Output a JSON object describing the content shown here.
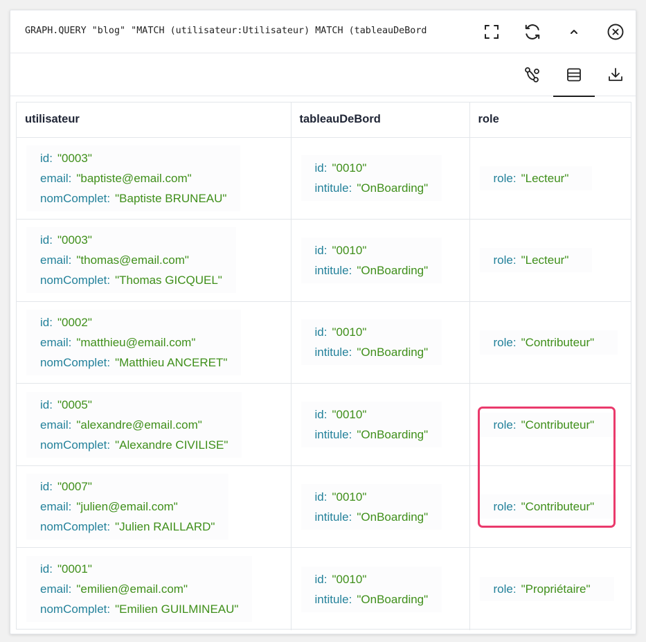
{
  "query": {
    "text": "GRAPH.QUERY \"blog\" \"MATCH (utilisateur:Utilisateur) MATCH (tableauDeBord",
    "icons": [
      "fullscreen-icon",
      "refresh-icon",
      "chevron-up-icon",
      "close-circle-icon"
    ]
  },
  "toolbar": {
    "icons": [
      "graph-view-icon",
      "table-view-icon",
      "download-icon"
    ],
    "active": "table-view"
  },
  "table": {
    "columns": [
      "utilisateur",
      "tableauDeBord",
      "role"
    ],
    "rows": [
      {
        "utilisateur": [
          [
            "id:",
            "\"0003\""
          ],
          [
            "email:",
            "\"baptiste@email.com\""
          ],
          [
            "nomComplet:",
            "\"Baptiste BRUNEAU\""
          ]
        ],
        "tableauDeBord": [
          [
            "id:",
            "\"0010\""
          ],
          [
            "intitule:",
            "\"OnBoarding\""
          ]
        ],
        "role": [
          [
            "role:",
            "\"Lecteur\""
          ]
        ]
      },
      {
        "utilisateur": [
          [
            "id:",
            "\"0003\""
          ],
          [
            "email:",
            "\"thomas@email.com\""
          ],
          [
            "nomComplet:",
            "\"Thomas GICQUEL\""
          ]
        ],
        "tableauDeBord": [
          [
            "id:",
            "\"0010\""
          ],
          [
            "intitule:",
            "\"OnBoarding\""
          ]
        ],
        "role": [
          [
            "role:",
            "\"Lecteur\""
          ]
        ]
      },
      {
        "utilisateur": [
          [
            "id:",
            "\"0002\""
          ],
          [
            "email:",
            "\"matthieu@email.com\""
          ],
          [
            "nomComplet:",
            "\"Matthieu ANCERET\""
          ]
        ],
        "tableauDeBord": [
          [
            "id:",
            "\"0010\""
          ],
          [
            "intitule:",
            "\"OnBoarding\""
          ]
        ],
        "role": [
          [
            "role:",
            "\"Contributeur\""
          ]
        ]
      },
      {
        "utilisateur": [
          [
            "id:",
            "\"0005\""
          ],
          [
            "email:",
            "\"alexandre@email.com\""
          ],
          [
            "nomComplet:",
            "\"Alexandre CIVILISE\""
          ]
        ],
        "tableauDeBord": [
          [
            "id:",
            "\"0010\""
          ],
          [
            "intitule:",
            "\"OnBoarding\""
          ]
        ],
        "role": [
          [
            "role:",
            "\"Contributeur\""
          ]
        ]
      },
      {
        "utilisateur": [
          [
            "id:",
            "\"0007\""
          ],
          [
            "email:",
            "\"julien@email.com\""
          ],
          [
            "nomComplet:",
            "\"Julien RAILLARD\""
          ]
        ],
        "tableauDeBord": [
          [
            "id:",
            "\"0010\""
          ],
          [
            "intitule:",
            "\"OnBoarding\""
          ]
        ],
        "role": [
          [
            "role:",
            "\"Contributeur\""
          ]
        ]
      },
      {
        "utilisateur": [
          [
            "id:",
            "\"0001\""
          ],
          [
            "email:",
            "\"emilien@email.com\""
          ],
          [
            "nomComplet:",
            "\"Emilien GUILMINEAU\""
          ]
        ],
        "tableauDeBord": [
          [
            "id:",
            "\"0010\""
          ],
          [
            "intitule:",
            "\"OnBoarding\""
          ]
        ],
        "role": [
          [
            "role:",
            "\"Propriétaire\""
          ]
        ]
      }
    ]
  },
  "colors": {
    "key": "#23819a",
    "value": "#3f8f1a",
    "highlight": "#ea3a6c"
  }
}
